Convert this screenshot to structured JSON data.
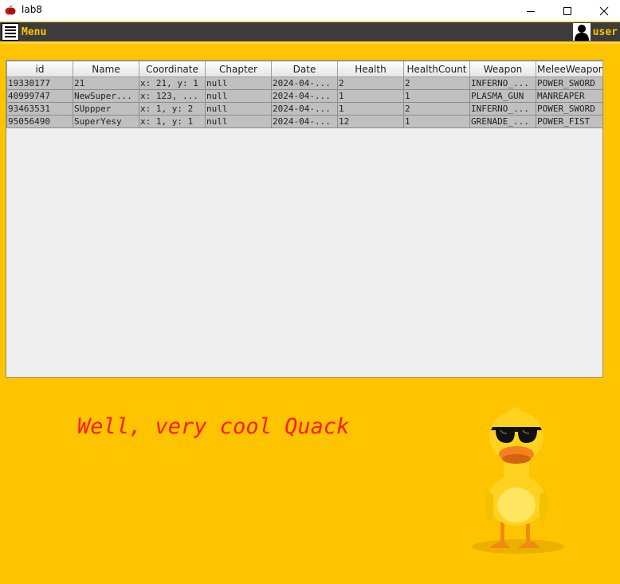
{
  "window": {
    "title": "lab8"
  },
  "menubar": {
    "menu_label": "Menu",
    "user_label": "user"
  },
  "table": {
    "columns": [
      "id",
      "Name",
      "Coordinate",
      "Chapter",
      "Date",
      "Health",
      "HealthCount",
      "Weapon",
      "MeleeWeapon"
    ],
    "rows": [
      [
        "19330177",
        "21",
        "x: 21, y: 1",
        "null",
        "2024-04-...",
        "2",
        "2",
        "INFERNO_...",
        "POWER_SWORD"
      ],
      [
        "40999747",
        "NewSuper...",
        "x: 123, ...",
        "null",
        "2024-04-...",
        "1",
        "1",
        "PLASMA_GUN",
        "MANREAPER"
      ],
      [
        "93463531",
        "SUppper",
        "x: 1, y: 2",
        "null",
        "2024-04-...",
        "1",
        "2",
        "INFERNO_...",
        "POWER_SWORD"
      ],
      [
        "95056490",
        "SuperYesy",
        "x: 1, y: 1",
        "null",
        "2024-04-...",
        "12",
        "1",
        "GRENADE_...",
        "POWER_FIST"
      ]
    ]
  },
  "footer": {
    "caption": "Well, very cool Quack"
  },
  "colors": {
    "accent": "#ffc400",
    "menubar": "#3c3c3c",
    "caption": "#ff1a1a"
  }
}
